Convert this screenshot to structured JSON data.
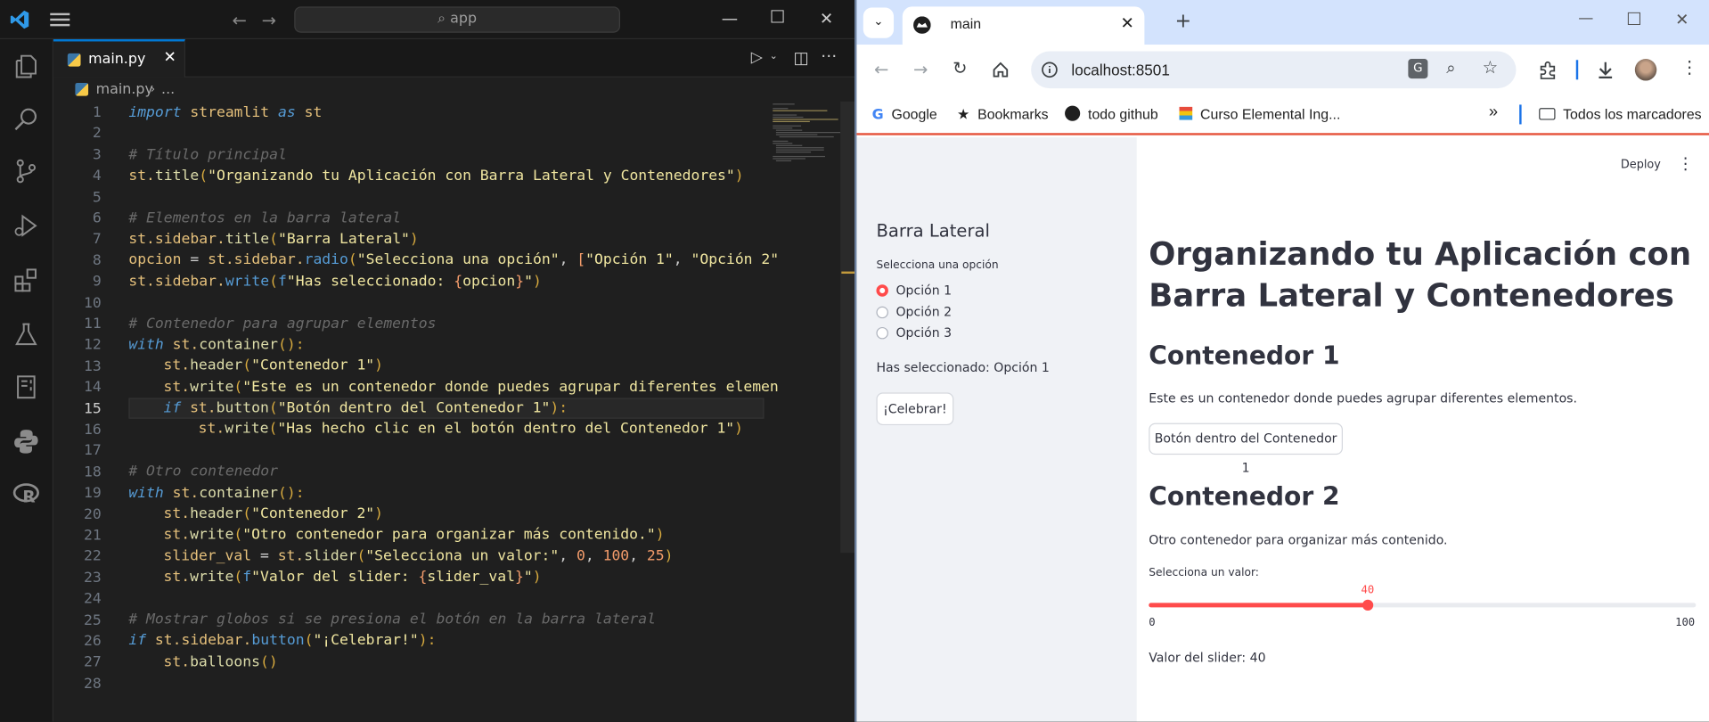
{
  "vscode": {
    "search_placeholder": "app",
    "tab": {
      "filename": "main.py",
      "close": "✕"
    },
    "breadcrumb": {
      "file": "main.py",
      "more": "..."
    },
    "code_lines": [
      {
        "n": "1"
      },
      {
        "n": "2"
      },
      {
        "n": "3"
      },
      {
        "n": "4"
      },
      {
        "n": "5"
      },
      {
        "n": "6"
      },
      {
        "n": "7"
      },
      {
        "n": "8"
      },
      {
        "n": "9"
      },
      {
        "n": "10"
      },
      {
        "n": "11"
      },
      {
        "n": "12"
      },
      {
        "n": "13"
      },
      {
        "n": "14"
      },
      {
        "n": "15"
      },
      {
        "n": "16"
      },
      {
        "n": "17"
      },
      {
        "n": "18"
      },
      {
        "n": "19"
      },
      {
        "n": "20"
      },
      {
        "n": "21"
      },
      {
        "n": "22"
      },
      {
        "n": "23"
      },
      {
        "n": "24"
      },
      {
        "n": "25"
      },
      {
        "n": "26"
      },
      {
        "n": "27"
      },
      {
        "n": "28"
      }
    ],
    "current_line": "15",
    "activity_icons": [
      "explorer-icon",
      "search-icon",
      "source-control-icon",
      "run-debug-icon",
      "extensions-icon",
      "testing-icon",
      "notebook-icon",
      "python-icon",
      "r-icon"
    ]
  },
  "code": {
    "l1": [
      "import",
      "streamlit",
      "as",
      "st"
    ],
    "l3": "# Título principal",
    "l4": [
      "st.",
      "title",
      "(",
      "\"Organizando tu Aplicación con Barra Lateral y Contenedores\"",
      ")"
    ],
    "l6": "# Elementos en la barra lateral",
    "l7": [
      "st.",
      "sidebar.",
      "title",
      "(",
      "\"Barra Lateral\"",
      ")"
    ],
    "l8": [
      "opcion",
      " = ",
      "st.",
      "sidebar.",
      "radio",
      "(",
      "\"Selecciona una opción\"",
      ", ",
      "[",
      "\"Opción 1\"",
      ", ",
      "\"Opción 2\""
    ],
    "l9": [
      "st.",
      "sidebar.",
      "write",
      "(",
      "f",
      "\"Has seleccionado: ",
      "{",
      "opcion",
      "}",
      "\"",
      ")"
    ],
    "l11": "# Contenedor para agrupar elementos",
    "l12": [
      "with",
      " st.",
      "container",
      "():"
    ],
    "l13": [
      "st.",
      "header",
      "(",
      "\"Contenedor 1\"",
      ")"
    ],
    "l14": [
      "st.",
      "write",
      "(",
      "\"Este es un contenedor donde puedes agrupar diferentes elemen"
    ],
    "l15": [
      "if",
      " st.",
      "button",
      "(",
      "\"Botón dentro del Contenedor 1\"",
      "):"
    ],
    "l16": [
      "st.",
      "write",
      "(",
      "\"Has hecho clic en el botón dentro del Contenedor 1\"",
      ")"
    ],
    "l18": "# Otro contenedor",
    "l19": [
      "with",
      " st.",
      "container",
      "():"
    ],
    "l20": [
      "st.",
      "header",
      "(",
      "\"Contenedor 2\"",
      ")"
    ],
    "l21": [
      "st.",
      "write",
      "(",
      "\"Otro contenedor para organizar más contenido.\"",
      ")"
    ],
    "l22": [
      "slider_val",
      " = ",
      "st.",
      "slider",
      "(",
      "\"Selecciona un valor:\"",
      ", ",
      "0",
      ", ",
      "100",
      ", ",
      "25",
      ")"
    ],
    "l23": [
      "st.",
      "write",
      "(",
      "f",
      "\"Valor del slider: ",
      "{",
      "slider_val",
      "}",
      "\"",
      ")"
    ],
    "l25": "# Mostrar globos si se presiona el botón en la barra lateral",
    "l26": [
      "if",
      " st.",
      "sidebar.",
      "button",
      "(",
      "\"¡Celebrar!\"",
      "):"
    ],
    "l27": [
      "st.",
      "balloons",
      "()"
    ]
  },
  "browser": {
    "tab_title": "main",
    "url": "localhost:8501",
    "bookmarks": [
      "Google",
      "Bookmarks",
      "todo github",
      "Curso Elemental Ing..."
    ],
    "all_bookmarks": "Todos los marcadores"
  },
  "app": {
    "deploy": "Deploy",
    "sidebar": {
      "title": "Barra Lateral",
      "radio_label": "Selecciona una opción",
      "options": [
        "Opción 1",
        "Opción 2",
        "Opción 3"
      ],
      "selected_text": "Has seleccionado: Opción 1",
      "celebrate_button": "¡Celebrar!"
    },
    "title": "Organizando tu Aplicación con Barra Lateral y Contenedores",
    "container1": {
      "header": "Contenedor 1",
      "text": "Este es un contenedor donde puedes agrupar diferentes elementos.",
      "button": "Botón dentro del Contenedor 1"
    },
    "container2": {
      "header": "Contenedor 2",
      "text": "Otro contenedor para organizar más contenido.",
      "slider_label": "Selecciona un valor:",
      "slider_value": "40",
      "slider_min": "0",
      "slider_max": "100",
      "slider_fraction": 0.4,
      "value_text": "Valor del slider: 40"
    }
  },
  "colors": {
    "accent": "#ff4b4b",
    "vscode_blue": "#0078d4",
    "chrome_frame": "#d3e3fd"
  }
}
